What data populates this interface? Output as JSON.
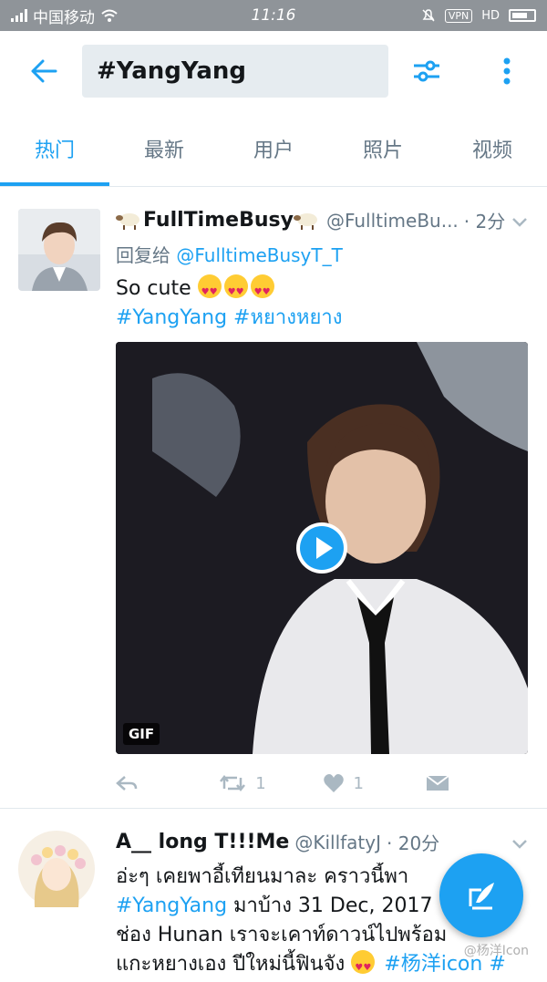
{
  "statusbar": {
    "carrier": "中国移动",
    "time": "11:16",
    "vpn": "VPN",
    "hd": "HD"
  },
  "header": {
    "search_value": "#YangYang"
  },
  "tabs": [
    "热门",
    "最新",
    "用户",
    "照片",
    "视频"
  ],
  "tweets": [
    {
      "name": "FullTimeBusy",
      "handle": "@FulltimeBu...",
      "time": "· 2分",
      "reply_prefix": "回复给",
      "reply_to": "@FulltimeBusyT_T",
      "text": "So cute",
      "tags": "#YangYang #หยางหยาง",
      "media_label": "GIF",
      "retweets": "1",
      "likes": "1"
    },
    {
      "name": "A__ long T!!!Me",
      "handle": "@KillfatyJ",
      "time": "· 20分",
      "line1": "อ่ะๆ เคยพาอี้เทียนมาละ คราวนี้พา",
      "line2_tag": "#YangYang",
      "line2_text": " มาบ้าง 31 Dec, 2017",
      "line3": "ช่อง Hunan เราจะเคาท์ดาวน์ไปพร้อม",
      "line4_text": "แกะหยางเอง ปีใหม่นี้ฟินจัง",
      "line4_tag": "#杨洋icon #"
    }
  ],
  "watermark": "@杨洋Icon",
  "colors": {
    "accent": "#1da1f2",
    "statusbar": "#8f9499",
    "muted": "#657786"
  }
}
